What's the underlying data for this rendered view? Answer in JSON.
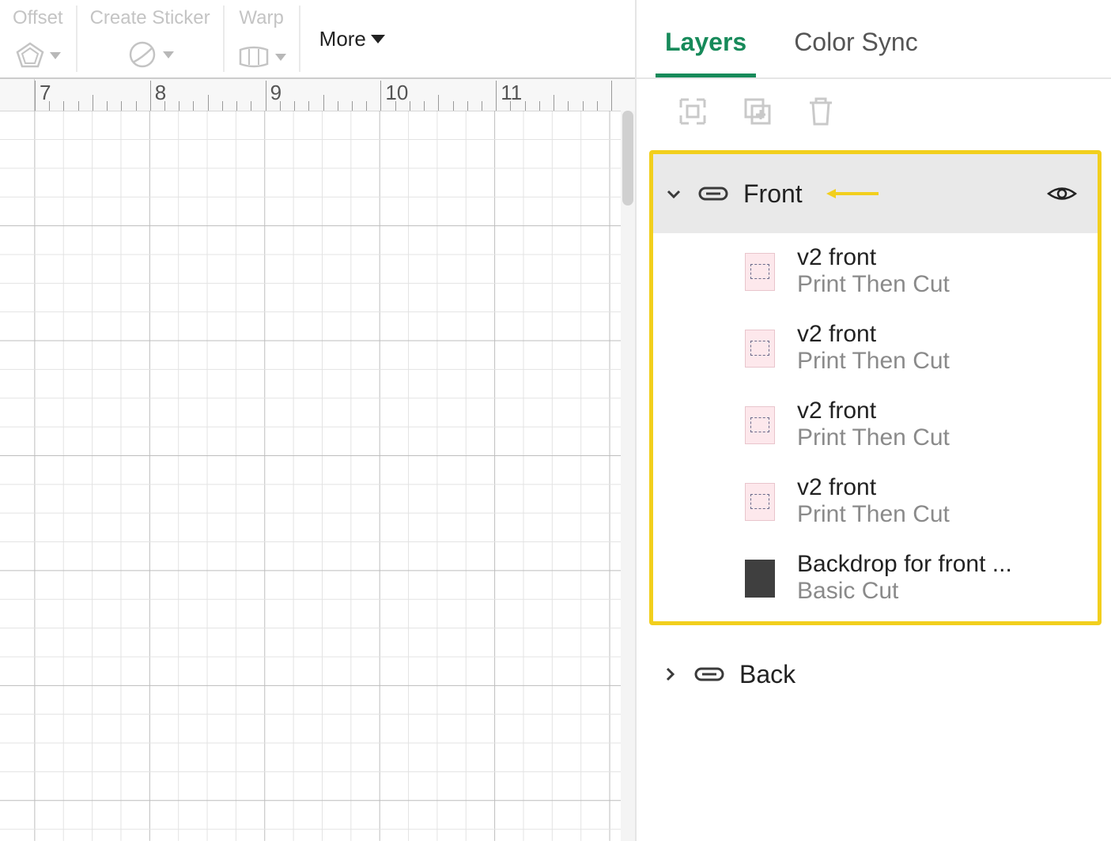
{
  "toolbar": {
    "offset_label": "Offset",
    "sticker_label": "Create Sticker",
    "warp_label": "Warp",
    "more_label": "More"
  },
  "ruler": {
    "start": 7,
    "labels": [
      "7",
      "8",
      "9",
      "10",
      "11"
    ]
  },
  "tabs": {
    "layers": "Layers",
    "color_sync": "Color Sync"
  },
  "groups": [
    {
      "name": "Front",
      "expanded": true,
      "highlighted": true,
      "items": [
        {
          "name": "v2 front",
          "sub": "Print Then Cut",
          "thumb": "ptc"
        },
        {
          "name": "v2 front",
          "sub": "Print Then Cut",
          "thumb": "ptc"
        },
        {
          "name": "v2 front",
          "sub": "Print Then Cut",
          "thumb": "ptc"
        },
        {
          "name": "v2 front",
          "sub": "Print Then Cut",
          "thumb": "ptc"
        },
        {
          "name": "Backdrop for front ...",
          "sub": "Basic Cut",
          "thumb": "solid"
        }
      ]
    },
    {
      "name": "Back",
      "expanded": false,
      "highlighted": false,
      "items": []
    }
  ],
  "annotation": {
    "arrow_color": "#f2cf1d"
  }
}
